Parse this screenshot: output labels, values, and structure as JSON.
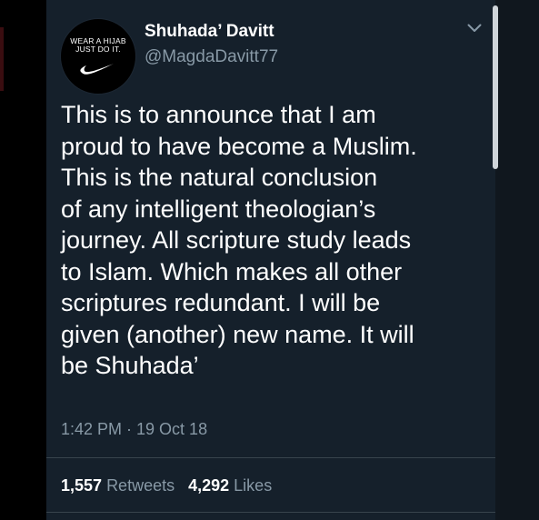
{
  "tweet": {
    "avatar_text_line1": "WEAR A HIJAB",
    "avatar_text_line2": "JUST DO IT.",
    "display_name": "Shuhada’ Davitt",
    "handle": "@MagdaDavitt77",
    "text_lines": [
      "This is to announce that I am",
      "proud to have become a Muslim.",
      "This is the natural conclusion",
      "of any intelligent theologian’s",
      "journey. All scripture study leads",
      "to Islam. Which makes all other",
      "scriptures redundant. I will be",
      "given (another) new name. It will",
      "be Shuhada’"
    ],
    "timestamp": "1:42 PM · 19 Oct 18",
    "retweets_count": "1,557",
    "retweets_label": "Retweets",
    "likes_count": "4,292",
    "likes_label": "Likes"
  },
  "icons": {
    "menu": "chevron-down-icon",
    "avatar_logo": "swoosh-icon"
  },
  "colors": {
    "background": "#15202b",
    "text_primary": "#ffffff",
    "text_secondary": "#8899a6",
    "divider": "#38444d"
  }
}
